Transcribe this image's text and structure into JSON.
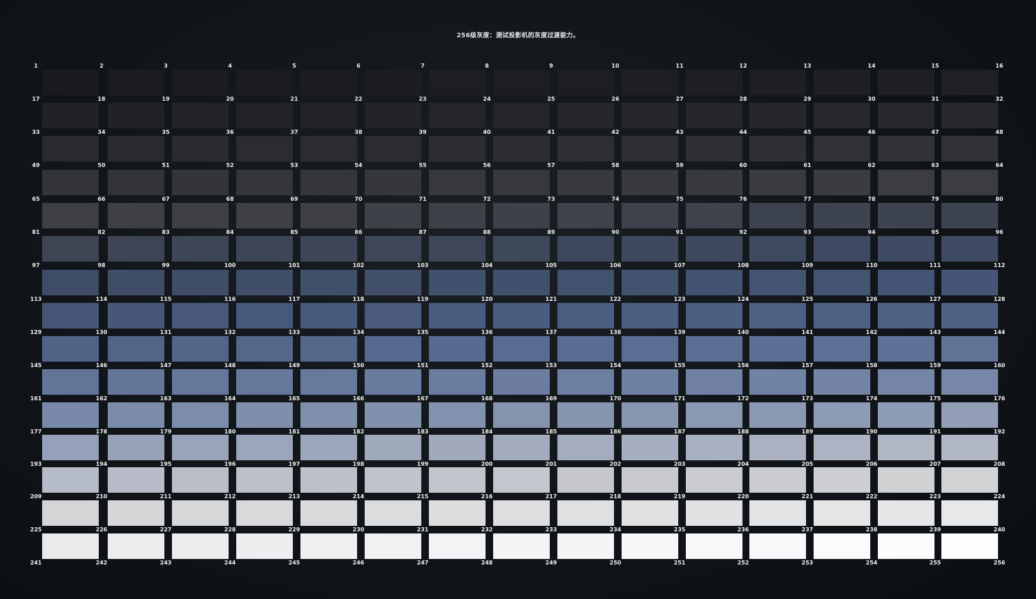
{
  "title": "256级灰度：测试投影机的灰度过渡能力。",
  "grid": {
    "columns": 16,
    "rows": 16,
    "first_number": 1,
    "last_number": 256
  },
  "colors": {
    "background": "#111519",
    "dark_patch": "#1c1f22",
    "mid_patch": "#5a5e6e",
    "bright_blue_patch": "#9fb6e8",
    "white_patch": "#fbfbfb",
    "label": "#eef0f0"
  }
}
